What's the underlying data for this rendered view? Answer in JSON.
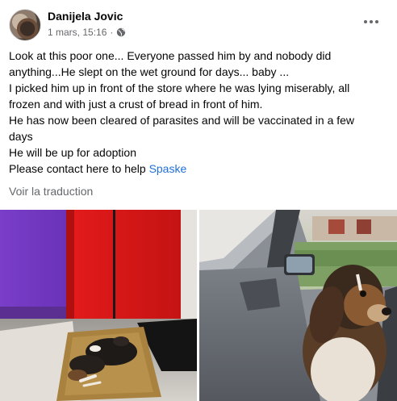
{
  "post": {
    "author": "Danijela Jovic",
    "date": "1 mars, 15:16",
    "separator": "·",
    "audience_icon": "globe-icon",
    "more_icon": "more-options-icon",
    "text_lines": [
      "Look at this poor one... Everyone passed him by and nobody did",
      "anything...He slept on the wet ground for days... baby ...",
      "I picked him up in front of the store where he was lying miserably, all",
      "frozen and with just a crust of bread in front of him.",
      "He has now been cleared of parasites and will be vaccinated in a few",
      "days",
      "He will be up for adoption"
    ],
    "contact_prefix": "Please contact here to help ",
    "contact_link": "Spaske",
    "translate_label": "Voir la traduction"
  },
  "colors": {
    "text": "#050505",
    "secondary_text": "#65676b",
    "link": "#216fdb"
  }
}
